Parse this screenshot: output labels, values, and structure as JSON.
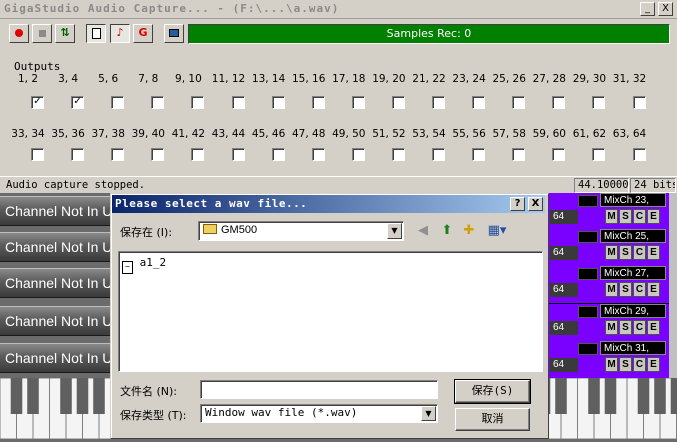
{
  "main_window": {
    "title": "GigaStudio Audio Capture...   - (F:\\...\\a.wav)",
    "title_buttons": [
      "_",
      "X"
    ],
    "toolbar": {
      "record_icon": "record-dot-icon",
      "stop_icon": "stop-square-icon",
      "loop_icon": "loop-arrows-icon",
      "g_label": "G",
      "samples_label": "Samples Rec: 0"
    },
    "outputs_label": "Outputs",
    "outputs_row1": [
      {
        "label": "1, 2",
        "checked": true
      },
      {
        "label": "3, 4",
        "checked": true
      },
      {
        "label": "5, 6",
        "checked": false
      },
      {
        "label": "7, 8",
        "checked": false
      },
      {
        "label": "9, 10",
        "checked": false
      },
      {
        "label": "11, 12",
        "checked": false
      },
      {
        "label": "13, 14",
        "checked": false
      },
      {
        "label": "15, 16",
        "checked": false
      },
      {
        "label": "17, 18",
        "checked": false
      },
      {
        "label": "19, 20",
        "checked": false
      },
      {
        "label": "21, 22",
        "checked": false
      },
      {
        "label": "23, 24",
        "checked": false
      },
      {
        "label": "25, 26",
        "checked": false
      },
      {
        "label": "27, 28",
        "checked": false
      },
      {
        "label": "29, 30",
        "checked": false
      },
      {
        "label": "31, 32",
        "checked": false
      }
    ],
    "outputs_row2": [
      {
        "label": "33, 34",
        "checked": false
      },
      {
        "label": "35, 36",
        "checked": false
      },
      {
        "label": "37, 38",
        "checked": false
      },
      {
        "label": "39, 40",
        "checked": false
      },
      {
        "label": "41, 42",
        "checked": false
      },
      {
        "label": "43, 44",
        "checked": false
      },
      {
        "label": "45, 46",
        "checked": false
      },
      {
        "label": "47, 48",
        "checked": false
      },
      {
        "label": "49, 50",
        "checked": false
      },
      {
        "label": "51, 52",
        "checked": false
      },
      {
        "label": "53, 54",
        "checked": false
      },
      {
        "label": "55, 56",
        "checked": false
      },
      {
        "label": "57, 58",
        "checked": false
      },
      {
        "label": "59, 60",
        "checked": false
      },
      {
        "label": "61, 62",
        "checked": false
      },
      {
        "label": "63, 64",
        "checked": false
      }
    ],
    "status": {
      "message": "Audio capture stopped.",
      "rate": "44.100000",
      "bits": "24 bits"
    }
  },
  "background_channels": {
    "left_label": "Channel Not In U",
    "right_strips": [
      {
        "num": "64",
        "mix": "MixCh 23,"
      },
      {
        "num": "64",
        "mix": "MixCh 25,"
      },
      {
        "num": "64",
        "mix": "MixCh 27,"
      },
      {
        "num": "64",
        "mix": "MixCh 29,"
      },
      {
        "num": "64",
        "mix": "MixCh 31,"
      }
    ],
    "mse": [
      "M",
      "S",
      "C",
      "E"
    ]
  },
  "dialog": {
    "title": "Please select a wav file...",
    "title_buttons": [
      "?",
      "X"
    ],
    "save_in_label": "保存在 (I):",
    "save_in_value": "GM500",
    "files": [
      {
        "name": "a1_2",
        "icon": "wav-file-icon"
      }
    ],
    "filename_label": "文件名 (N):",
    "filename_value": "",
    "filetype_label": "保存类型 (T):",
    "filetype_value": "Window wav file (*.wav)",
    "save_button": "保存(S)",
    "cancel_button": "取消"
  },
  "colors": {
    "samples_bg": "#008000",
    "dialog_title_start": "#0a246a",
    "dialog_title_end": "#a6caf0",
    "channel_purple": "#7a00ff",
    "record_red": "#e00000"
  }
}
